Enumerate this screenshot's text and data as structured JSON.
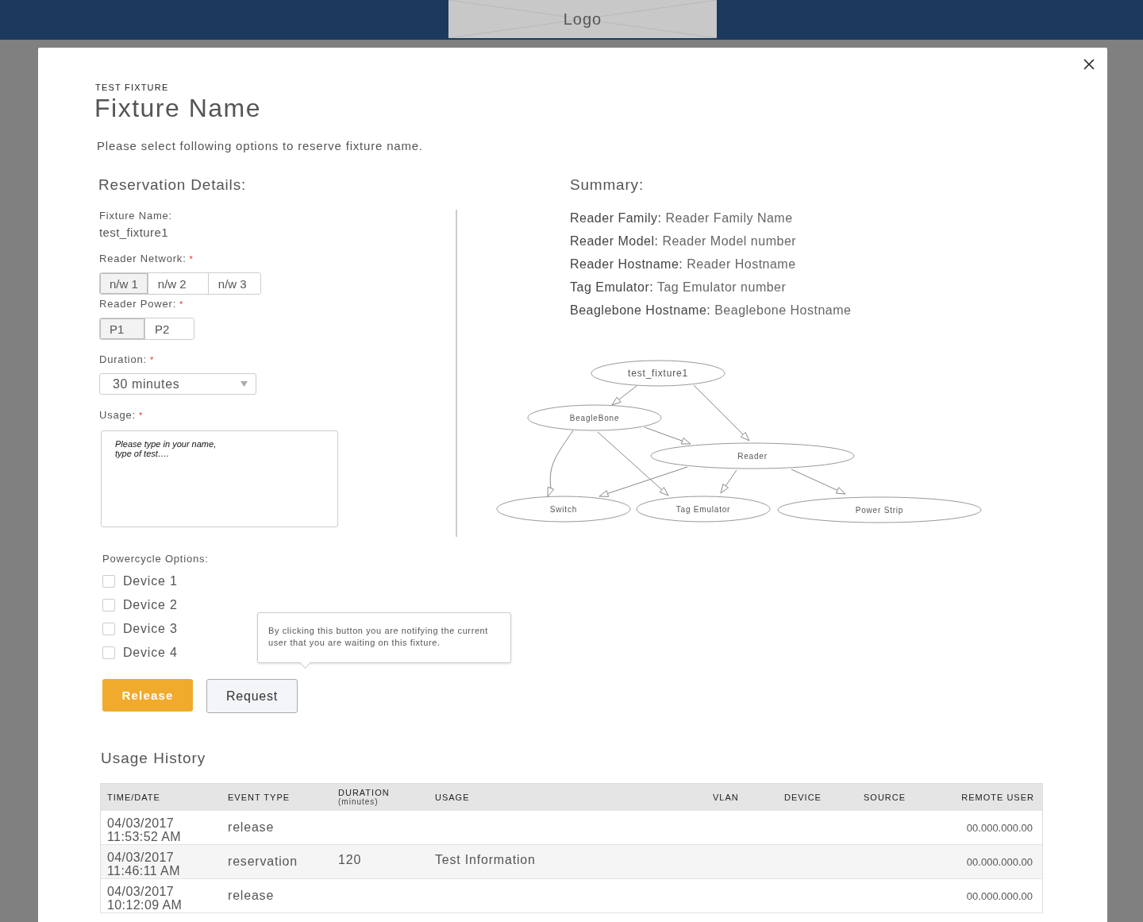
{
  "header": {
    "logo": "Logo"
  },
  "dialog": {
    "eyebrow": "TEST FIXTURE",
    "title": "Fixture Name",
    "subtitle": "Please select following options to reserve fixture name.",
    "details": {
      "heading": "Reservation Details:",
      "fixture_label": "Fixture Name:",
      "fixture_value": "test_fixture1",
      "network": {
        "label": "Reader Network:",
        "required": "*",
        "options": [
          {
            "label": "n/w 1",
            "selected": true
          },
          {
            "label": "n/w 2",
            "selected": false
          },
          {
            "label": "n/w 3",
            "selected": false
          }
        ]
      },
      "power": {
        "label": "Reader Power:",
        "required": "*",
        "options": [
          {
            "label": "P1",
            "selected": true
          },
          {
            "label": "P2",
            "selected": false
          }
        ]
      },
      "duration": {
        "label": "Duration:",
        "required": "*",
        "value": "30 minutes"
      },
      "usage": {
        "label": "Usage:",
        "required": "*",
        "placeholder": "Please type in your name,\ntype of test…."
      },
      "powercycle": {
        "label": "Powercycle Options:",
        "devices": [
          {
            "label": "Device 1",
            "checked": false
          },
          {
            "label": "Device 2",
            "checked": false
          },
          {
            "label": "Device 3",
            "checked": false
          },
          {
            "label": "Device 4",
            "checked": false
          }
        ]
      },
      "buttons": {
        "release": "Release",
        "request": "Request",
        "tooltip": "By clicking this button you are notifying the current user that you are waiting on this fixture."
      }
    },
    "summary": {
      "heading": "Summary:",
      "items": [
        {
          "label": "Reader Family:",
          "value": "Reader Family Name"
        },
        {
          "label": "Reader Model:",
          "value": "Reader Model number"
        },
        {
          "label": "Reader Hostname:",
          "value": "Reader Hostname"
        },
        {
          "label": "Tag Emulator:",
          "value": "Tag Emulator number"
        },
        {
          "label": "Beaglebone Hostname:",
          "value": "Beaglebone Hostname"
        }
      ],
      "diagram": {
        "nodes": [
          "test_fixture1",
          "BeagleBone",
          "Reader",
          "Switch",
          "Tag Emulator",
          "Power Strip"
        ]
      }
    },
    "history": {
      "title": "Usage History",
      "columns": [
        {
          "label": "TIME/DATE"
        },
        {
          "label": "EVENT TYPE"
        },
        {
          "label": "DURATION",
          "sub": "(minutes)"
        },
        {
          "label": "USAGE"
        },
        {
          "label": "VLAN"
        },
        {
          "label": "DEVICE"
        },
        {
          "label": "SOURCE"
        },
        {
          "label": "REMOTE USER"
        }
      ],
      "rows": [
        {
          "date": "04/03/2017",
          "time": "11:53:52 AM",
          "event": "release",
          "remote_user": "00.000.000.00"
        },
        {
          "date": "04/03/2017",
          "time": "11:46:11 AM",
          "event": "reservation",
          "duration": "120",
          "usage": "Test Information",
          "remote_user": "00.000.000.00"
        },
        {
          "date": "04/03/2017",
          "time": "10:12:09 AM",
          "event": "release",
          "remote_user": "00.000.000.00"
        }
      ]
    }
  }
}
